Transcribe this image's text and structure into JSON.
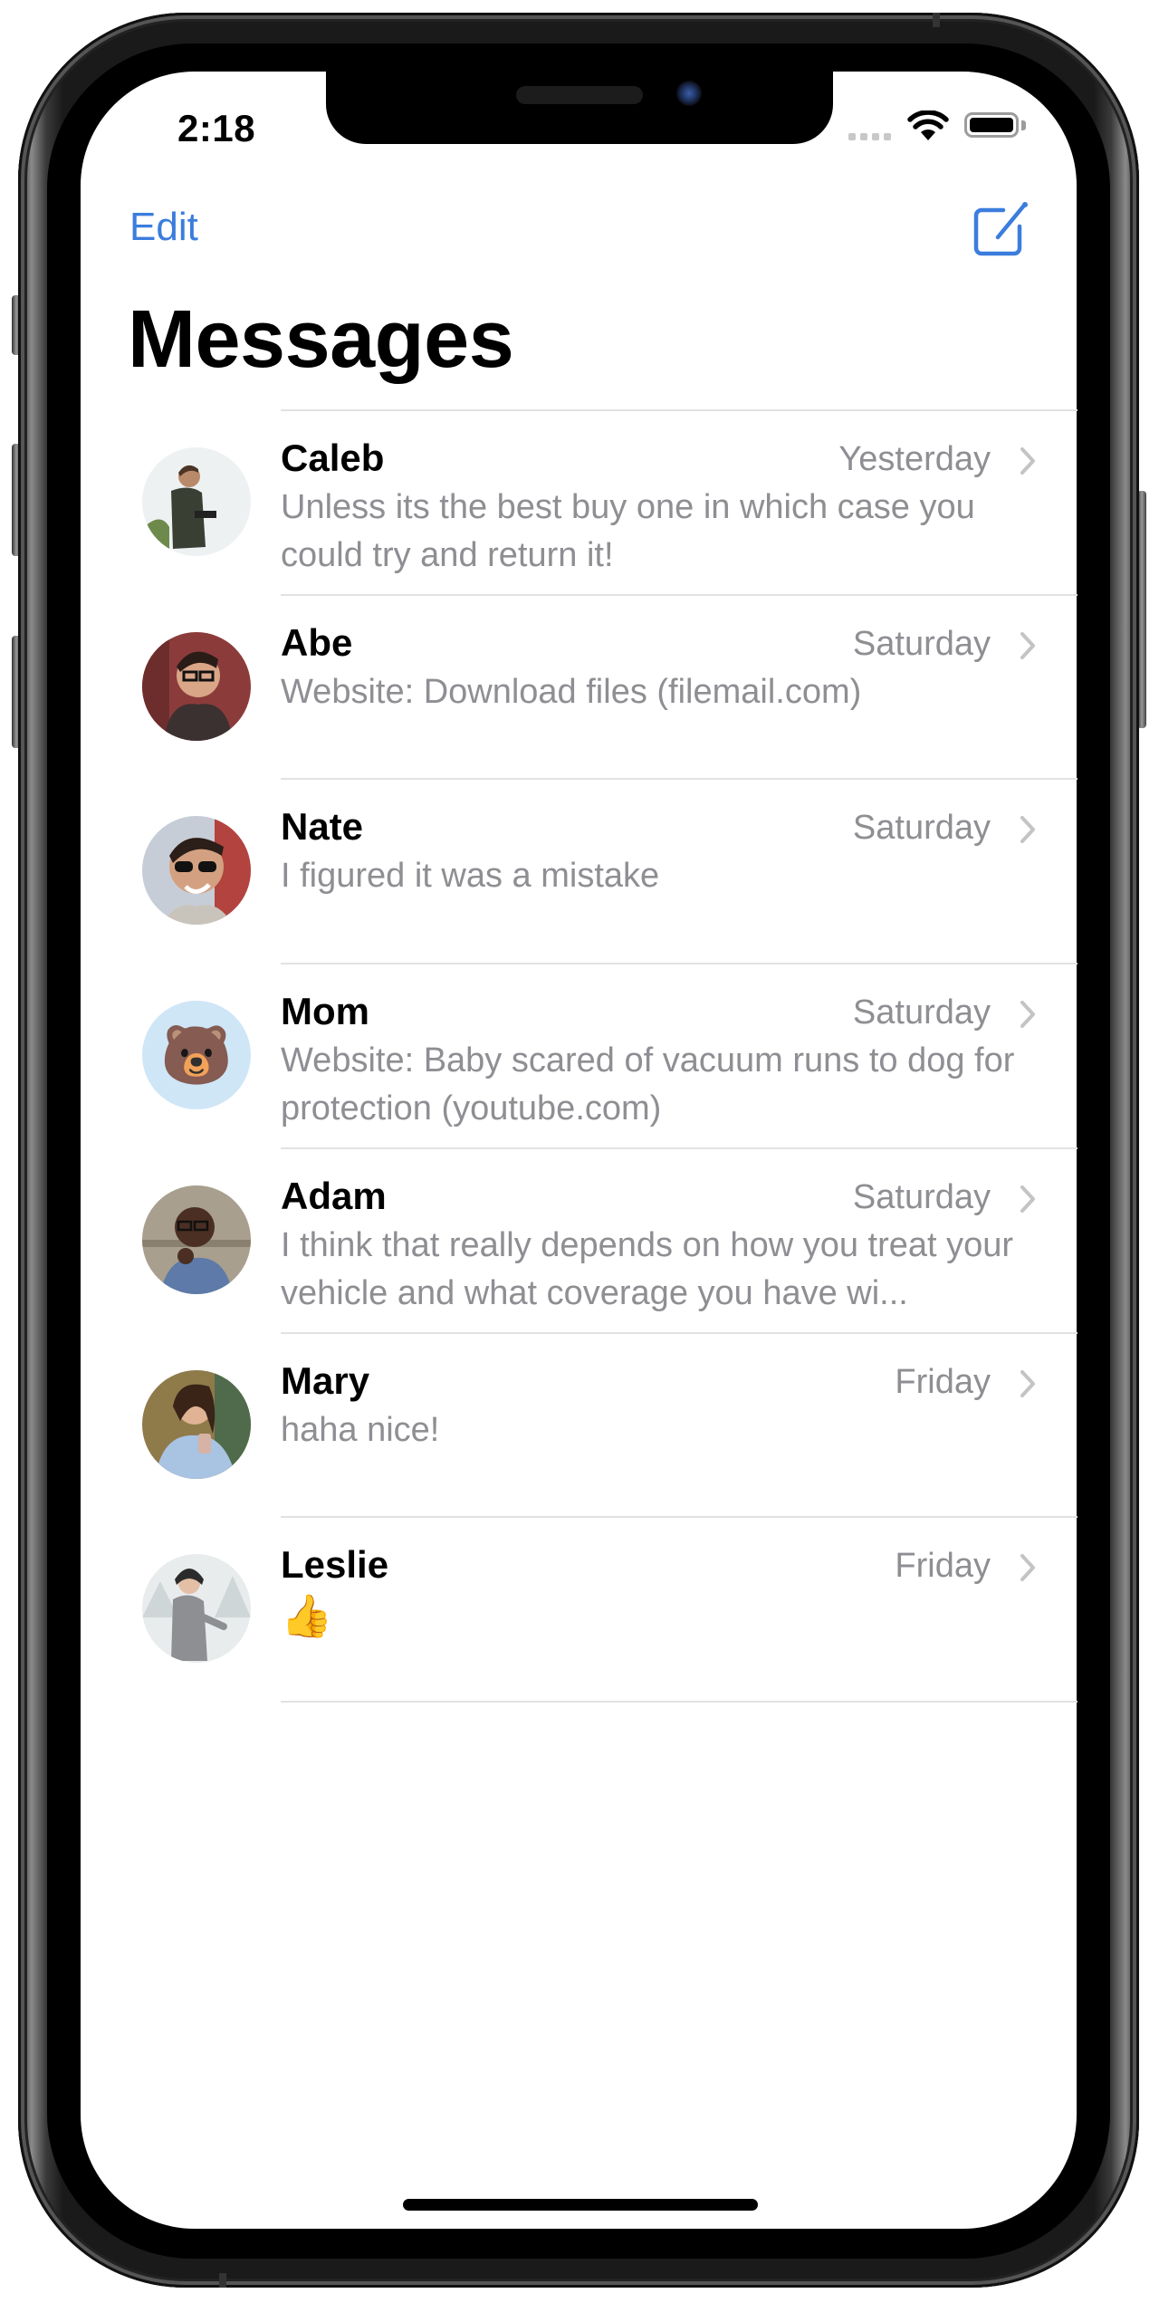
{
  "status_bar": {
    "time": "2:18",
    "signal_icon": "cellular-signal-icon",
    "wifi_icon": "wifi-icon",
    "battery_icon": "battery-icon"
  },
  "nav": {
    "edit_label": "Edit",
    "compose_icon": "compose-icon",
    "title": "Messages"
  },
  "colors": {
    "accent": "#3b7ddd",
    "secondary_text": "#8e8e93",
    "separator": "#e2e2e4",
    "chevron": "#c4c4c7"
  },
  "conversations": [
    {
      "name": "Caleb",
      "date": "Yesterday",
      "preview": "Unless its the best buy one in which case you could try and return it!",
      "avatar": "photo-man-outdoors"
    },
    {
      "name": "Abe",
      "date": "Saturday",
      "preview": "Website: Download files (filemail.com)",
      "avatar": "photo-man-glasses"
    },
    {
      "name": "Nate",
      "date": "Saturday",
      "preview": "I figured it was a mistake",
      "avatar": "photo-man-sunglasses"
    },
    {
      "name": "Mom",
      "date": "Saturday",
      "preview": "Website: Baby scared of vacuum runs to dog for protection (youtube.com)",
      "avatar": "bear-emoji",
      "avatar_emoji": "🐻"
    },
    {
      "name": "Adam",
      "date": "Saturday",
      "preview": "I think that really depends on how you treat your vehicle and what coverage you have wi...",
      "avatar": "photo-man-thinking"
    },
    {
      "name": "Mary",
      "date": "Friday",
      "preview": "haha nice!",
      "avatar": "photo-woman-phone"
    },
    {
      "name": "Leslie",
      "date": "Friday",
      "preview": "👍",
      "avatar": "photo-woman-snow"
    }
  ]
}
